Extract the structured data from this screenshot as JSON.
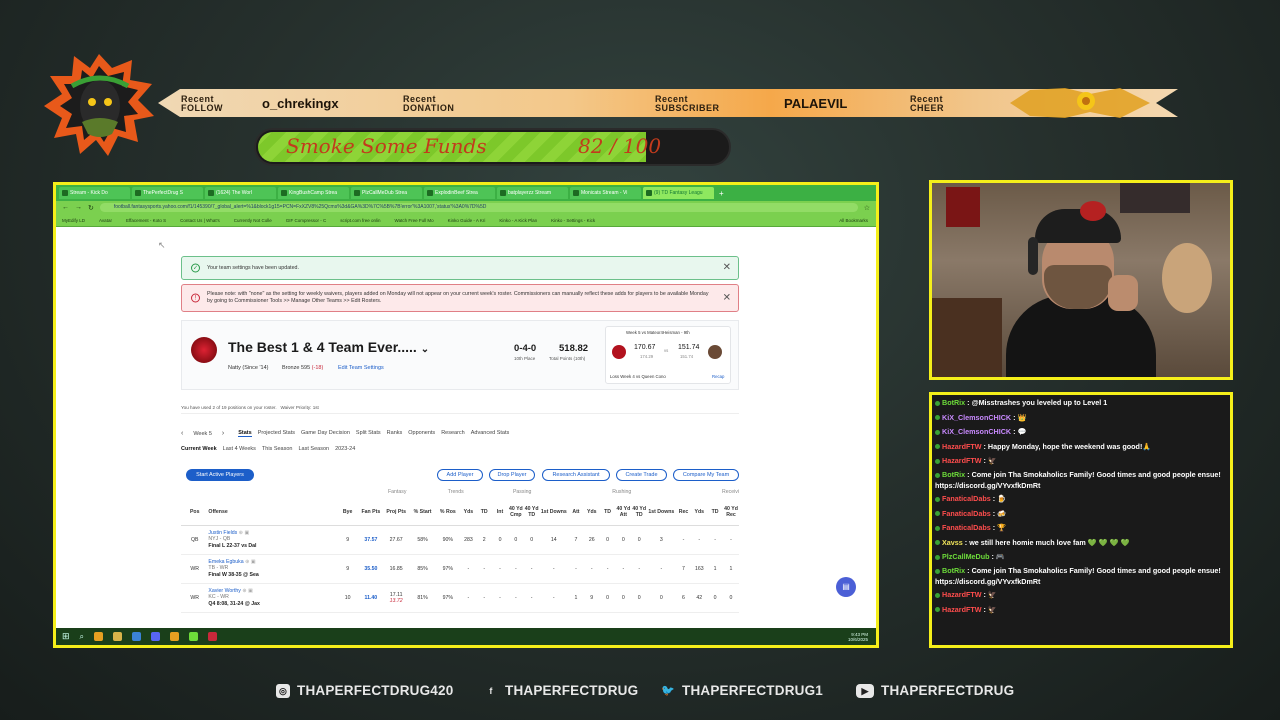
{
  "banner": {
    "follow": {
      "k1": "Recent",
      "k2": "FOLLOW",
      "value": "o_chrekingx"
    },
    "donation": {
      "k1": "Recent",
      "k2": "DONATION",
      "value": ""
    },
    "subscriber": {
      "k1": "Recent",
      "k2": "SUBSCRIBER",
      "value": "PALAEVIL"
    },
    "cheer": {
      "k1": "Recent",
      "k2": "CHEER",
      "value": ""
    }
  },
  "goal": {
    "title": "Smoke Some Funds",
    "progress": "82 / 100",
    "fraction": 0.82
  },
  "browser": {
    "tabs": [
      "Stream - Kick Do",
      "ThePerfectDrug S",
      "(1624) The Worl",
      "KingBushCamp Strea",
      "PlzCallMeDub Strea",
      "ExplodinBeef Strea",
      "batplayerzz Stream",
      "Monicats Stream - Vi",
      "(9) TD Fantasy Leagu"
    ],
    "url": "football.fantasysports.yahoo.com/f1/145390/7_global_alert=%1&block1g15=PCN=FxXZV8%25Qcms%3d&GA%3D%7C%5B%7B'error'%3A1007,'status'%3A0%7D%5D",
    "bookmarks": [
      "MyEdify LD",
      "Avatar",
      "Effacement - Koto S",
      "Contact Us | What's",
      "Currently Not Colle",
      "GIF Compressor - C",
      "script.com free onlin",
      "Watch Free Full Mo",
      "Kinko Guide - A Kri",
      "Kinko - A Kick Plan",
      "Kinko - Settings - Kick",
      "All Bookmarks"
    ],
    "alert_ok": "Your team settings have been updated.",
    "alert_err": "Please note: with \"none\" as the setting for weekly waivers, players added on Monday will not appear on your current week's roster. Commissioners can manually reflect these adds for players to be available Monday by going to Commissioner Tools >> Manage Other Teams >> Edit Rosters.",
    "team": {
      "name": "The Best 1 & 4 Team Ever.....",
      "since": "Natty (Since '14)",
      "league": "Bronze 595",
      "league_change": "(-18)",
      "edit": "Edit Team Settings",
      "record": "0-4-0",
      "place": "10th Place",
      "points": "518.82",
      "points_label": "Total Points (10th)"
    },
    "match": {
      "title": "Week 5 vs Mateor4Heisman - 9th",
      "score1": "170.67",
      "proj1": "174.29",
      "vs": "vs",
      "score2": "151.74",
      "proj2": "151.74",
      "footer": "Loss Week 4 vs Queen Cono",
      "recap": "Recap"
    },
    "roster_info": "You have used 2 of 19 positions on your roster.",
    "waiver": "Waiver Priority: 1st",
    "week": "Week 5",
    "subtabs": [
      "Stats",
      "Projected Stats",
      "Game Day Decision",
      "Split Stats",
      "Ranks",
      "Opponents",
      "Research",
      "Advanced Stats"
    ],
    "periods": [
      "Current Week",
      "Last 4 Weeks",
      "This Season",
      "Last Season",
      "2023-24"
    ],
    "buttons": {
      "start": "Start Active Players",
      "add": "Add Player",
      "drop": "Drop Player",
      "assist": "Research Assistant",
      "trade": "Create Trade",
      "compare": "Compare My Team"
    },
    "groups": [
      "Fantasy",
      "Trends",
      "Passing",
      "Rushing",
      "Receivi"
    ],
    "headers": [
      "Pos",
      "Offense",
      "Bye",
      "Fan Pts",
      "Proj Pts",
      "% Start",
      "% Ros",
      "Yds",
      "TD",
      "Int",
      "40 Yd Cmp",
      "40 Yd TD",
      "1st Downs",
      "Att",
      "Yds",
      "TD",
      "40 Yd Att",
      "40 Yd TD",
      "1st Downs",
      "Rec",
      "Yds",
      "TD",
      "40 Yd Rec"
    ],
    "rows": [
      {
        "pos": "QB",
        "name": "Justin Fields",
        "team": "NYJ - QB",
        "game": "Final L 22-37 vs Dal",
        "bye": "9",
        "fan": "37.57",
        "proj": "27.67",
        "start": "58%",
        "ros": "90%",
        "c": [
          "283",
          "2",
          "0",
          "0",
          "0",
          "14",
          "7",
          "26",
          "0",
          "0",
          "0",
          "3",
          "-",
          "-",
          "-",
          "-"
        ]
      },
      {
        "pos": "WR",
        "name": "Emeka Egbuka",
        "team": "TB - WR",
        "game": "Final W 38-35 @ Sea",
        "bye": "9",
        "fan": "35.50",
        "proj": "16.85",
        "start": "85%",
        "ros": "97%",
        "c": [
          "-",
          "-",
          "-",
          "-",
          "-",
          "-",
          "-",
          "-",
          "-",
          "-",
          "-",
          "-",
          "7",
          "163",
          "1",
          "1"
        ]
      },
      {
        "pos": "WR",
        "name": "Xavier Worthy",
        "team": "KC - WR",
        "game": "Q4 8:08, 31-24 @ Jax",
        "bye": "10",
        "fan": "11.40",
        "proj": "17.11",
        "proj2": "13.72",
        "start": "81%",
        "ros": "97%",
        "c": [
          "-",
          "-",
          "-",
          "-",
          "-",
          "-",
          "1",
          "9",
          "0",
          "0",
          "0",
          "0",
          "6",
          "42",
          "0",
          "0"
        ]
      }
    ],
    "clock": {
      "time": "9:43 PM",
      "date": "10/6/2025"
    }
  },
  "chat": [
    {
      "user": "BotRix",
      "color": "#6ddc3a",
      "msg": "@Misstrashes you leveled up to Level 1"
    },
    {
      "user": "KiX_ClemsonCHICK",
      "color": "#c98aff",
      "msg": "👑"
    },
    {
      "user": "KiX_ClemsonCHICK",
      "color": "#c98aff",
      "msg": "💬"
    },
    {
      "user": "HazardFTW",
      "color": "#ff4d4d",
      "msg": "Happy Monday, hope the weekend was good!🙏"
    },
    {
      "user": "HazardFTW",
      "color": "#ff4d4d",
      "msg": "🦅"
    },
    {
      "user": "BotRix",
      "color": "#6ddc3a",
      "msg": "Come join Tha Smokaholics Family! Good times and good people ensue! https://discord.gg/VYvxfkDmRt"
    },
    {
      "user": "FanaticalDabs",
      "color": "#ff4d4d",
      "msg": "🍺"
    },
    {
      "user": "FanaticalDabs",
      "color": "#ff4d4d",
      "msg": "🍻"
    },
    {
      "user": "FanaticalDabs",
      "color": "#ff4d4d",
      "msg": "🏆"
    },
    {
      "user": "Xavss",
      "color": "#f0e35a",
      "msg": "we still here homie much love fam 💚 💚 💚 💚"
    },
    {
      "user": "PlzCallMeDub",
      "color": "#6ddc3a",
      "msg": "🎮"
    },
    {
      "user": "BotRix",
      "color": "#6ddc3a",
      "msg": "Come join Tha Smokaholics Family! Good times and good people ensue! https://discord.gg/VYvxfkDmRt"
    },
    {
      "user": "HazardFTW",
      "color": "#ff4d4d",
      "msg": "🦅"
    },
    {
      "user": "HazardFTW",
      "color": "#ff4d4d",
      "msg": "🦅"
    }
  ],
  "socials": [
    {
      "icon": "instagram-icon",
      "glyph": "◎",
      "text": "THAPERFECTDRUG420"
    },
    {
      "icon": "facebook-icon",
      "glyph": "f",
      "text": "THAPERFECTDRUG"
    },
    {
      "icon": "twitter-icon",
      "glyph": "🐦",
      "text": "THAPERFECTDRUG1"
    },
    {
      "icon": "youtube-icon",
      "glyph": "▶",
      "text": "THAPERFECTDRUG"
    }
  ]
}
